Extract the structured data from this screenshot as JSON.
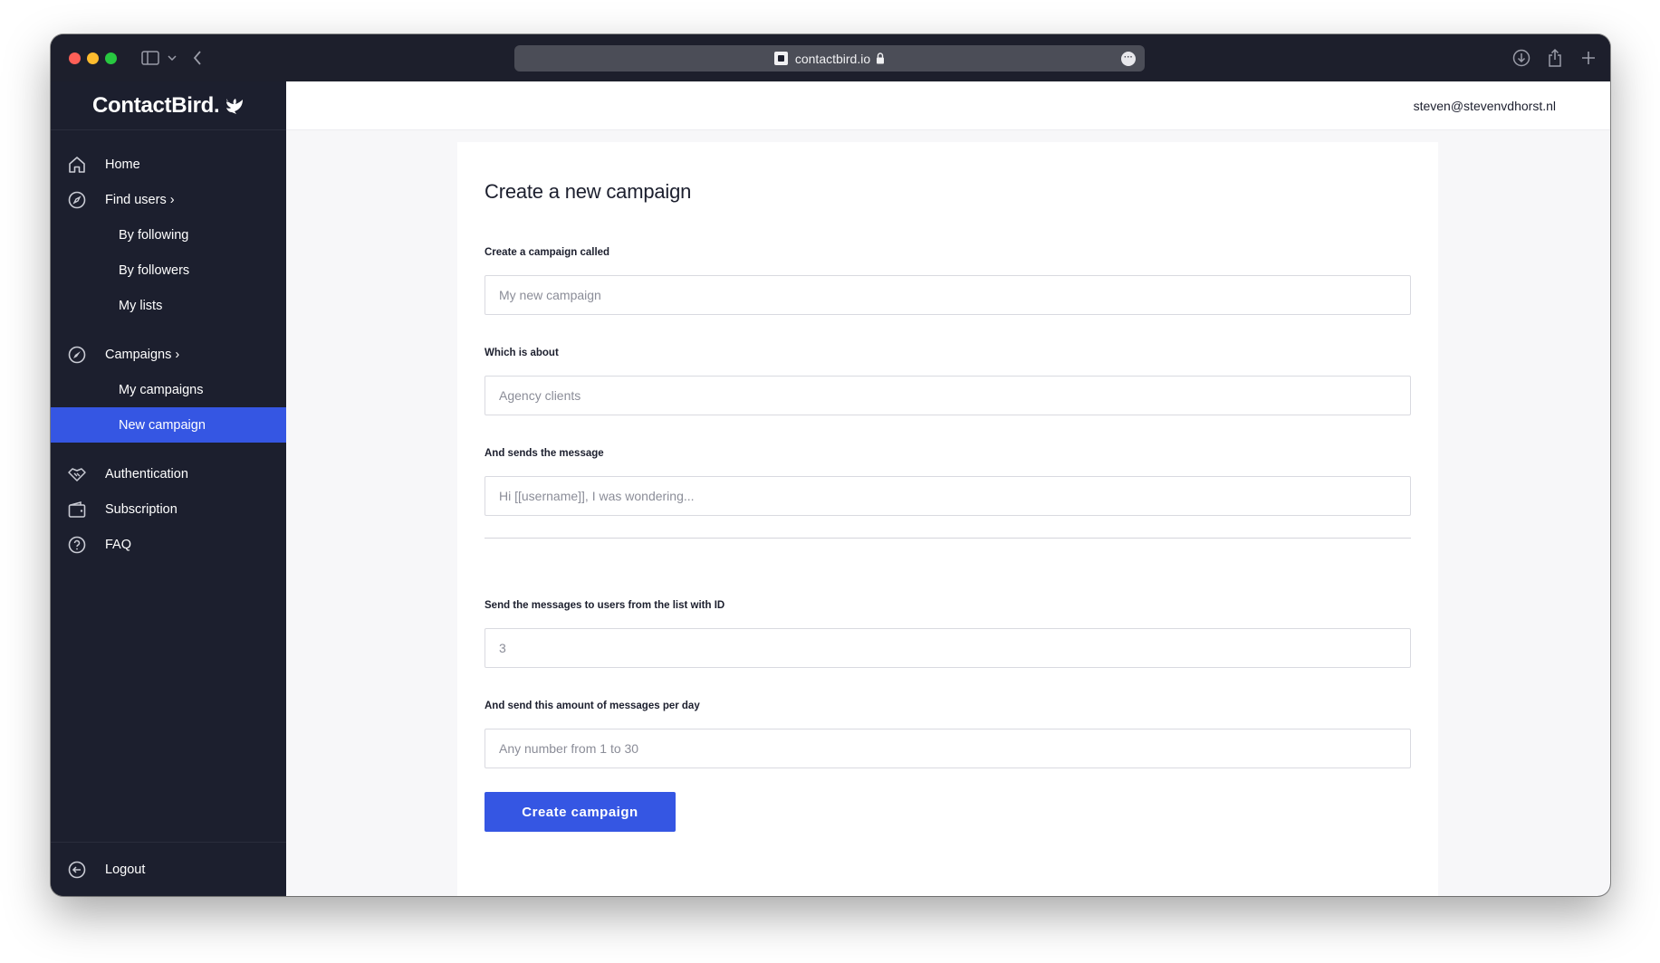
{
  "browser": {
    "url": "contactbird.io"
  },
  "app": {
    "logo": "ContactBird.",
    "user_email": "steven@stevenvdhorst.nl"
  },
  "sidebar": {
    "items": [
      {
        "label": "Home",
        "icon": "home-icon"
      },
      {
        "label": "Find users ›",
        "icon": "compass-icon"
      },
      {
        "label": "By following"
      },
      {
        "label": "By followers"
      },
      {
        "label": "My lists"
      },
      {
        "label": "Campaigns ›",
        "icon": "rocket-icon"
      },
      {
        "label": "My campaigns"
      },
      {
        "label": "New campaign",
        "active": true
      },
      {
        "label": "Authentication",
        "icon": "handshake-icon"
      },
      {
        "label": "Subscription",
        "icon": "wallet-icon"
      },
      {
        "label": "FAQ",
        "icon": "help-circle-icon"
      }
    ],
    "logout": {
      "label": "Logout",
      "icon": "logout-icon"
    }
  },
  "form": {
    "title": "Create a new campaign",
    "fields": [
      {
        "label": "Create a campaign called",
        "placeholder": "My new campaign"
      },
      {
        "label": "Which is about",
        "placeholder": "Agency clients"
      },
      {
        "label": "And sends the message",
        "placeholder": "Hi [[username]], I was wondering..."
      },
      {
        "label": "Send the messages to users from the list with ID",
        "placeholder": "3"
      },
      {
        "label": "And send this amount of messages per day",
        "placeholder": "Any number from 1 to 30"
      }
    ],
    "submit_label": "Create campaign"
  },
  "colors": {
    "sidebar_bg": "#1c1f2e",
    "accent": "#3556e3"
  }
}
